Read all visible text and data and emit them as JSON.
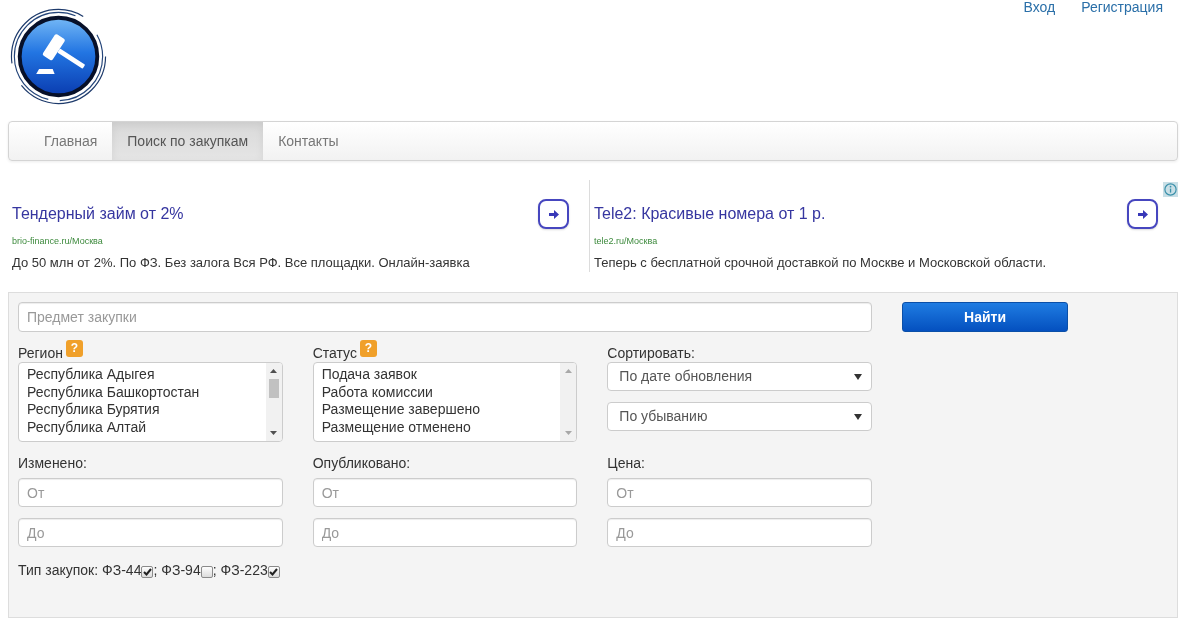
{
  "header_links": [
    {
      "label": "Вход"
    },
    {
      "label": "Регистрация"
    }
  ],
  "nav": {
    "tabs": [
      {
        "label": "Главная",
        "selected": false
      },
      {
        "label": "Поиск по закупкам",
        "selected": true
      },
      {
        "label": "Контакты",
        "selected": false
      }
    ]
  },
  "ads": [
    {
      "title": "Тендерный займ от 2%",
      "url": "brio-finance.ru/Москва",
      "description": "До 50 млн от 2%. По ФЗ. Без залога Вся РФ. Все площадки. Онлайн-заявка"
    },
    {
      "title": "Tele2: Красивые номера от 1 р.",
      "url": "tele2.ru/Москва",
      "description": "Теперь с бесплатной срочной доставкой по Москве и Московской области."
    }
  ],
  "search": {
    "subject": {
      "placeholder": "Предмет закупки"
    },
    "submit": {
      "label": "Найти"
    },
    "lists": [
      {
        "label": "Регион",
        "help": "?",
        "scrollable": true,
        "options": [
          "Республика Адыгея",
          "Республика Башкортостан",
          "Республика Бурятия",
          "Республика Алтай"
        ]
      },
      {
        "label": "Статус",
        "help": "?",
        "scrollable": false,
        "options": [
          "Подача заявок",
          "Работа комиссии",
          "Размещение завершено",
          "Размещение отменено"
        ]
      }
    ],
    "sort": {
      "label": "Сортировать:",
      "selects": [
        {
          "value": "По дате обновления"
        },
        {
          "value": "По убыванию"
        }
      ]
    },
    "ranges": [
      {
        "label": "Изменено:",
        "from": {
          "placeholder": "От"
        },
        "to": {
          "placeholder": "До"
        }
      },
      {
        "label": "Опубликовано:",
        "from": {
          "placeholder": "От"
        },
        "to": {
          "placeholder": "До"
        }
      },
      {
        "label": "Цена:",
        "from": {
          "placeholder": "От"
        },
        "to": {
          "placeholder": "До"
        }
      }
    ],
    "types": {
      "label": "Тип закупок:",
      "separator": ";",
      "items": [
        {
          "label": "ФЗ-44",
          "checked": true
        },
        {
          "label": "ФЗ-94",
          "checked": false
        },
        {
          "label": "ФЗ-223",
          "checked": true
        }
      ]
    }
  }
}
